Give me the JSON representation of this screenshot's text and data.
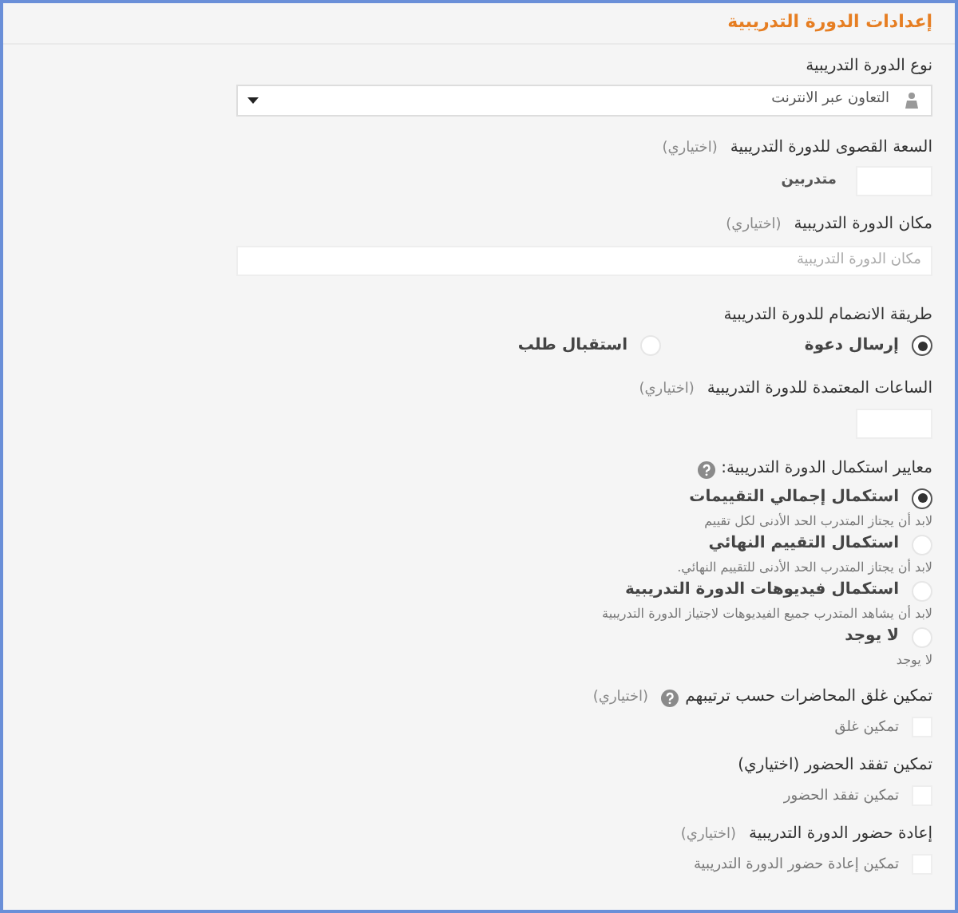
{
  "title": "إعدادات الدورة التدريبية",
  "fields": [
    {
      "kind": "select",
      "label": "نوع الدورة التدريبية",
      "value": "التعاون عبر الانترنت"
    },
    {
      "kind": "number",
      "label": "السعة القصوى للدورة التدريبية",
      "optional": "(اختياري)",
      "suffix": "متدربين"
    },
    {
      "kind": "text",
      "label": "مكان الدورة التدريبية",
      "optional": "(اختياري)",
      "placeholder": "مكان الدورة التدريبية"
    },
    {
      "kind": "radio_inline",
      "label": "طريقة الانضمام للدورة التدريبية",
      "options": [
        {
          "label": "إرسال دعوة",
          "selected": true
        },
        {
          "label": "استقبال طلب",
          "selected": false
        }
      ]
    },
    {
      "kind": "number",
      "label": "الساعات المعتمدة للدورة التدريبية",
      "optional": "(اختياري)"
    },
    {
      "kind": "radio_list",
      "label": "معايير استكمال الدورة التدريبية:",
      "help": true,
      "options": [
        {
          "label": "استكمال إجمالي التقييمات",
          "description": "لابد أن يجتاز المتدرب الحد الأدنى لكل تقييم",
          "selected": true
        },
        {
          "label": "استكمال التقييم النهائي",
          "description": "لابد أن يجتاز المتدرب الحد الأدنى للتقييم النهائي.",
          "selected": false
        },
        {
          "label": "استكمال فيديوهات الدورة التدريبية",
          "description": "لابد أن يشاهد المتدرب جميع الفيديوهات لاجتياز الدورة التدريبية",
          "selected": false
        },
        {
          "label": "لا يوجد",
          "description": "لا يوجد",
          "selected": false
        }
      ]
    },
    {
      "kind": "checkbox",
      "label": "تمكين غلق المحاضرات حسب ترتيبهم",
      "help": true,
      "optional": "(اختياري)",
      "checkbox_label": "تمكين غلق",
      "checked": false
    },
    {
      "kind": "checkbox",
      "label": "تمكين تفقد الحضور (اختياري)",
      "checkbox_label": "تمكين تفقد الحضور",
      "checked": false
    },
    {
      "kind": "checkbox",
      "label": "إعادة حضور الدورة التدريبية",
      "optional": "(اختياري)",
      "checkbox_label": "تمكين إعادة حضور الدورة التدريبية",
      "checked": false
    }
  ]
}
